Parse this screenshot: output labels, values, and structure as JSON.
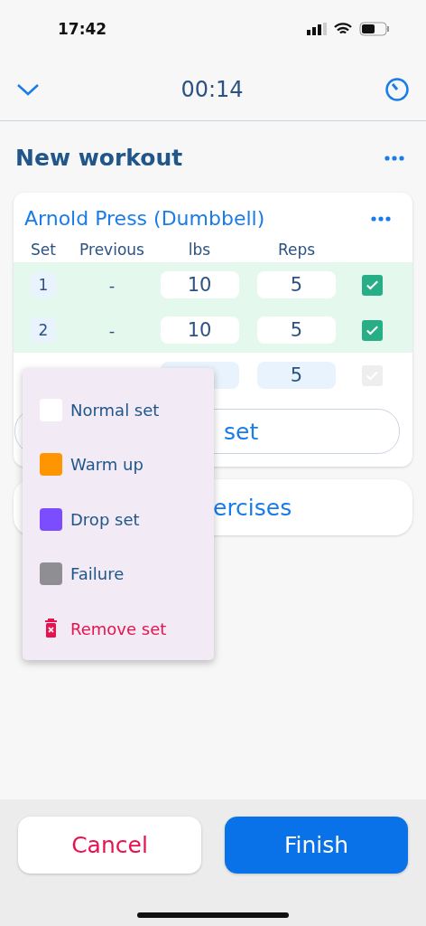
{
  "status_bar": {
    "time": "17:42"
  },
  "header": {
    "timer": "00:14"
  },
  "workout": {
    "title": "New workout"
  },
  "exercise": {
    "name": "Arnold Press (Dumbbell)",
    "columns": [
      "Set",
      "Previous",
      "lbs",
      "Reps"
    ],
    "sets": [
      {
        "set": "1",
        "previous": "-",
        "lbs": "10",
        "reps": "5",
        "checked": true
      },
      {
        "set": "2",
        "previous": "-",
        "lbs": "10",
        "reps": "5",
        "checked": true
      },
      {
        "reps": "5",
        "checked": false
      }
    ],
    "add_set_button": "set"
  },
  "add_exercises_button": "ercises",
  "set_type_menu": {
    "items": [
      {
        "kind": "type",
        "label": "Normal set",
        "color": "#ffffff"
      },
      {
        "kind": "type",
        "label": "Warm up",
        "color": "#ff9500"
      },
      {
        "kind": "type",
        "label": "Drop set",
        "color": "#7c4dff"
      },
      {
        "kind": "type",
        "label": "Failure",
        "color": "#8e8e93"
      },
      {
        "kind": "remove",
        "label": "Remove set"
      }
    ]
  },
  "footer": {
    "cancel": "Cancel",
    "finish": "Finish"
  }
}
